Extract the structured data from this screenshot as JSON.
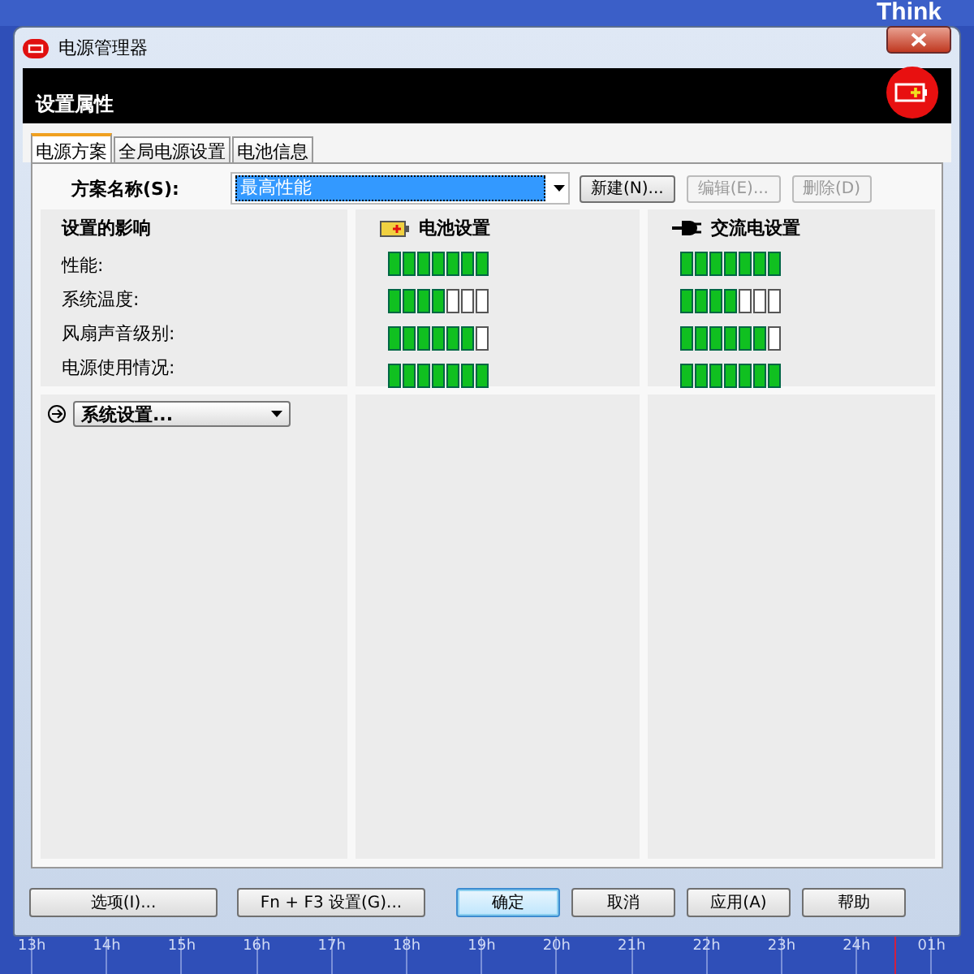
{
  "desktop": {
    "logo": "Think",
    "timeline": [
      "13h",
      "14h",
      "15h",
      "16h",
      "17h",
      "18h",
      "19h",
      "20h",
      "21h",
      "22h",
      "23h",
      "24h",
      "01h"
    ]
  },
  "window": {
    "title": "电源管理器"
  },
  "header": {
    "title": "设置属性"
  },
  "tabs": [
    {
      "label": "电源方案",
      "selected": true
    },
    {
      "label": "全局电源设置",
      "selected": false
    },
    {
      "label": "电池信息",
      "selected": false
    }
  ],
  "scheme": {
    "label": "方案名称(S):",
    "value": "最高性能",
    "buttons": [
      {
        "label": "新建(N)...",
        "disabled": false
      },
      {
        "label": "编辑(E)...",
        "disabled": true
      },
      {
        "label": "删除(D)",
        "disabled": true
      }
    ]
  },
  "impact": {
    "title": "设置的影响",
    "rows": [
      "性能:",
      "系统温度:",
      "风扇声音级别:",
      "电源使用情况:"
    ]
  },
  "profiles": [
    {
      "kind": "battery",
      "title": "电池设置",
      "meters": [
        {
          "level": 1
        },
        {
          "level": 0.571
        },
        {
          "level": 0.857
        },
        {
          "level": 1
        }
      ]
    },
    {
      "kind": "ac",
      "title": "交流电设置",
      "meters": [
        {
          "level": 1
        },
        {
          "level": 0.571
        },
        {
          "level": 0.857
        },
        {
          "level": 1
        }
      ]
    }
  ],
  "system_settings": {
    "label": "系统设置..."
  },
  "buttons": [
    {
      "label": "选项(I)...",
      "default": false
    },
    {
      "label": "Fn + F3 设置(G)...",
      "default": false
    },
    {
      "label": "确定",
      "default": true
    },
    {
      "label": "取消",
      "default": false
    },
    {
      "label": "应用(A)",
      "default": false
    },
    {
      "label": "帮助",
      "default": false
    }
  ]
}
